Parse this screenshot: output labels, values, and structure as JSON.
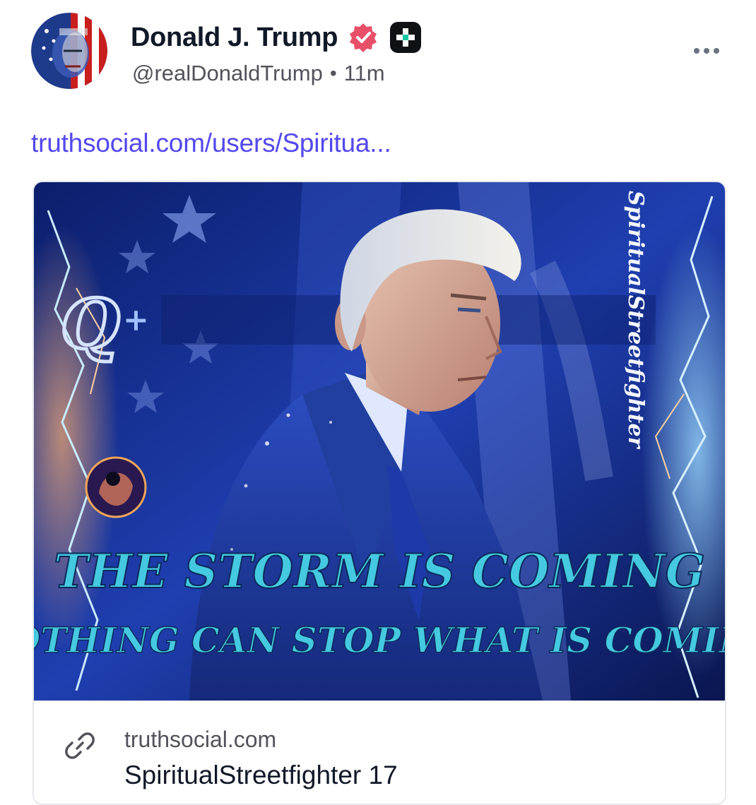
{
  "post": {
    "author": {
      "display_name": "Donald J. Trump",
      "handle": "@realDonaldTrump",
      "time_ago": "11m",
      "separator": "•",
      "verified": true,
      "verified_color": "#e8506a"
    },
    "link_text": "truthsocial.com/users/Spiritua...",
    "link_color": "#5448ee",
    "card": {
      "image_text": {
        "headline": "THE STORM IS COMING",
        "subheadline": "NOTHING CAN STOP WHAT IS COMING",
        "watermark": "SpiritualStreetfighter",
        "q_mark": "Q",
        "q_plus": "+"
      },
      "domain": "truthsocial.com",
      "title": "SpiritualStreetfighter 17",
      "link_icon": "link-chain-icon"
    }
  }
}
